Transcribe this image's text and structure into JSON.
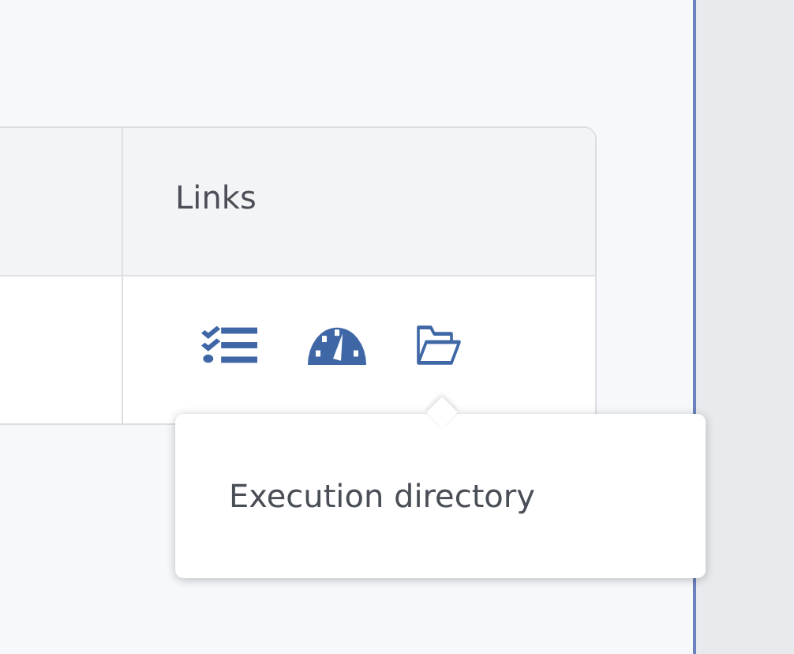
{
  "table": {
    "columns": [
      "Links"
    ],
    "rows": [
      {
        "links": [
          {
            "kind": "checklist"
          },
          {
            "kind": "gauge"
          },
          {
            "kind": "folder"
          }
        ]
      }
    ]
  },
  "tooltip": {
    "text": "Execution directory"
  }
}
